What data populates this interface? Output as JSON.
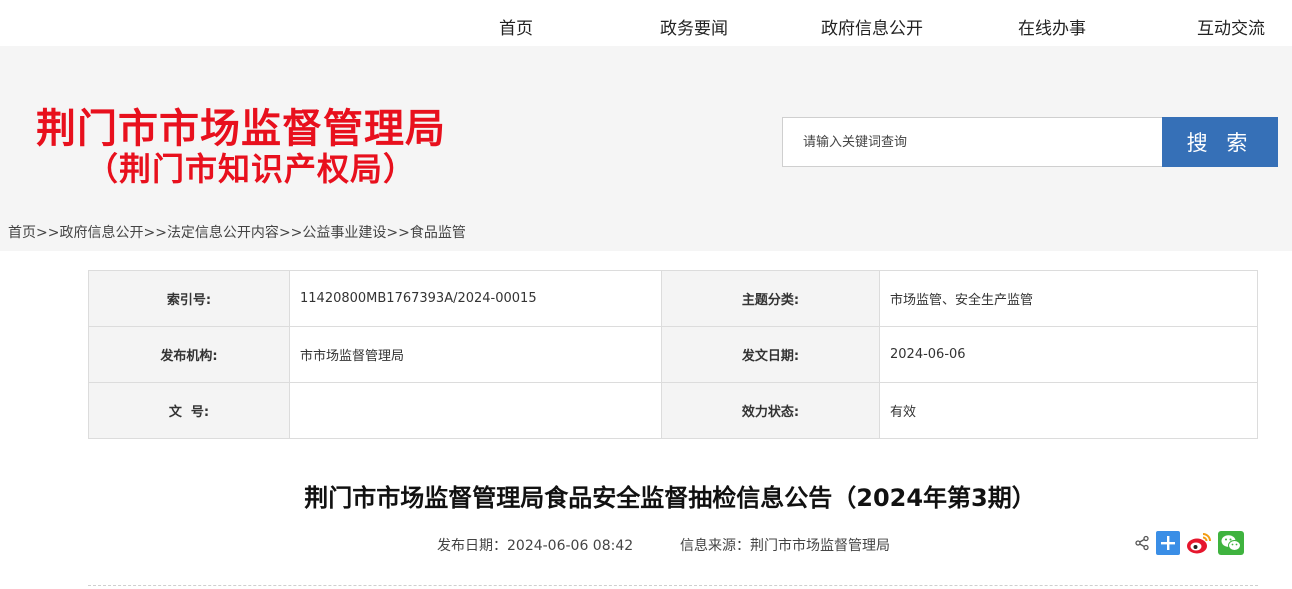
{
  "nav": {
    "items": [
      "首页",
      "政务要闻",
      "政府信息公开",
      "在线办事",
      "互动交流"
    ]
  },
  "logo": {
    "main": "荆门市市场监督管理局",
    "sub": "（荆门市知识产权局）"
  },
  "search": {
    "placeholder": "请输入关键词查询",
    "button_label": "搜 索"
  },
  "breadcrumb": {
    "items": [
      "首页",
      "政府信息公开",
      "法定信息公开内容",
      "公益事业建设",
      "食品监管"
    ],
    "separator": ">>"
  },
  "meta": {
    "index_label": "索引号:",
    "index_value": "11420800MB1767393A/2024-00015",
    "topic_label": "主题分类:",
    "topic_value": "市场监管、安全生产监管",
    "publisher_label": "发布机构:",
    "publisher_value": "市市场监督管理局",
    "date_label": "发文日期:",
    "date_value": "2024-06-06",
    "docno_label": "文  号:",
    "docno_value": "",
    "status_label": "效力状态:",
    "status_value": "有效"
  },
  "article": {
    "title": "荆门市市场监督管理局食品安全监督抽检信息公告（2024年第3期）",
    "publish_date": "发布日期：2024-06-06 08:42",
    "source": "信息来源：荆门市市场监督管理局"
  },
  "colors": {
    "logo_red": "#e8101d",
    "search_blue": "#3670b7",
    "header_bg": "#f5f5f5"
  },
  "icons": [
    "share-icon",
    "add-share-icon",
    "weibo-icon",
    "wechat-icon"
  ]
}
